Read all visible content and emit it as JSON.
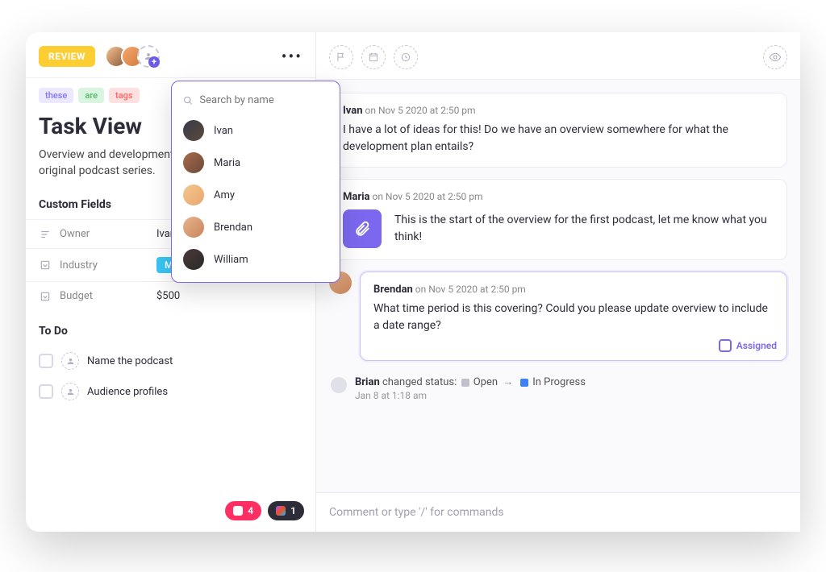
{
  "header": {
    "status_badge": "REVIEW"
  },
  "tags": [
    "these",
    "are",
    "tags"
  ],
  "task": {
    "title": "Task View",
    "description": "Overview and development plan for our upcoming original podcast series."
  },
  "sections": {
    "custom_fields": "Custom Fields",
    "todo": "To Do"
  },
  "fields": {
    "owner_label": "Owner",
    "owner_value": "Ivan",
    "industry_label": "Industry",
    "industry_value": "Museum",
    "budget_label": "Budget",
    "budget_value": "$500"
  },
  "todos": [
    {
      "label": "Name the podcast"
    },
    {
      "label": "Audience profiles"
    }
  ],
  "integrations": {
    "invision_count": "4",
    "figma_count": "1"
  },
  "people_search": {
    "placeholder": "Search by name",
    "people": [
      {
        "name": "Ivan"
      },
      {
        "name": "Maria"
      },
      {
        "name": "Amy"
      },
      {
        "name": "Brendan"
      },
      {
        "name": "William"
      }
    ]
  },
  "feed": {
    "c1": {
      "author": "Ivan",
      "timestamp": "on Nov 5 2020 at 2:50 pm",
      "body": "I have a lot of ideas for this! Do we have an overview somewhere for what the development plan entails?"
    },
    "c2": {
      "author": "Maria",
      "timestamp": "on Nov 5 2020 at 2:50 pm",
      "body": "This is the start of the overview for the first podcast, let me know what you think!"
    },
    "c3": {
      "author": "Brendan",
      "timestamp": "on Nov 5 2020 at 2:50 pm",
      "body": "What time period is this covering? Could you please update overview to include a date range?",
      "assigned_label": "Assigned"
    },
    "activity": {
      "actor": "Brian",
      "text": "changed status:",
      "from": "Open",
      "to": "In Progress",
      "time": "Jan 8 at 1:18 am"
    }
  },
  "composer": {
    "placeholder": "Comment or type '/' for commands"
  }
}
